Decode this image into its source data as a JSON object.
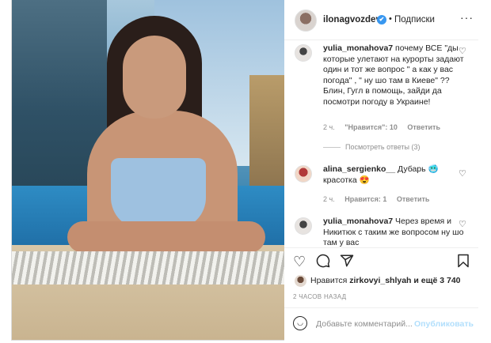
{
  "post": {
    "author": "ilonagvozdeva",
    "verified_mark": "✔",
    "separator": "•",
    "follow_label": "Подписки",
    "more_label": "···"
  },
  "comments": [
    {
      "username": "yulia_monahova7",
      "text": "почему ВСЕ \"ды которые улетают на курорты задают один и тот же вопрос \" а как у вас погода\" , \" ну шо там в Киеве\" ?? Блин, Гугл в помощь, зайди да посмотри погоду в Украине!",
      "time": "2 ч.",
      "likes": "\"Нравится\": 10",
      "reply": "Ответить",
      "view_replies": "Посмотреть ответы (3)"
    },
    {
      "username": "alina_sergienko__",
      "text": "Дубарь 🥶 красотка 😍",
      "time": "2 ч.",
      "likes": "Нравится: 1",
      "reply": "Ответить"
    },
    {
      "username": "yulia_monahova7",
      "text": "Через время и Никитюк с таким же вопросом ну шо там у вас"
    }
  ],
  "likes_summary": {
    "prefix": "Нравится",
    "user": "zirkovyi_shlyah",
    "suffix": "и ещё 3 740"
  },
  "timestamp": "2 ЧАСОВ НАЗАД",
  "add_comment": {
    "placeholder": "Добавьте комментарий...",
    "post_label": "Опубликовать"
  },
  "icons": {
    "like": "heart-icon",
    "comment": "comment-icon",
    "share": "paper-plane-icon",
    "save": "bookmark-icon",
    "emoji": "smile-icon"
  },
  "colors": {
    "verified": "#3897f0",
    "muted_text": "#8e8e8e",
    "post_disabled": "#b2dffc"
  }
}
